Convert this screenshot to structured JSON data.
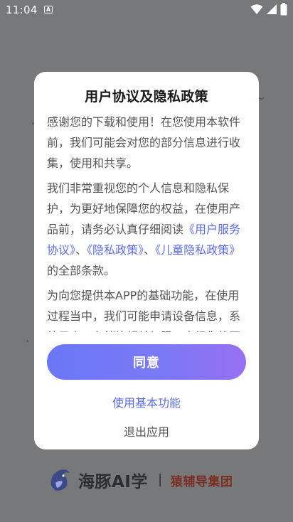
{
  "status_bar": {
    "time": "11:04",
    "notification_icon": "A"
  },
  "background": {
    "brand_name": "海豚AI学",
    "group_name": "猿辅导集团"
  },
  "dialog": {
    "title": "用户协议及隐私政策",
    "paragraph1": "感谢您的下载和使用！在您使用本软件前，我们可能会对您的部分信息进行收集，使用和共享。",
    "paragraph2_prefix": "我们非常重视您的个人信息和隐私保护，为更好地保障您的权益，在使用产品前，请务必认真仔细阅读",
    "link_service": "《用户服务协议》",
    "sep1": "、",
    "link_privacy": "《隐私政策》",
    "sep2": "、",
    "link_child": "《儿童隐私政策》",
    "paragraph2_suffix": "的全部条款。",
    "paragraph3": "为向您提供本APP的基础功能，在使用过程当中，我们可能申请设备信息，系统日志，存储等相关权限。未经您的同意，我们不会开启这些权限。",
    "agree_label": "同意",
    "basic_func_label": "使用基本功能",
    "exit_label": "退出应用"
  }
}
